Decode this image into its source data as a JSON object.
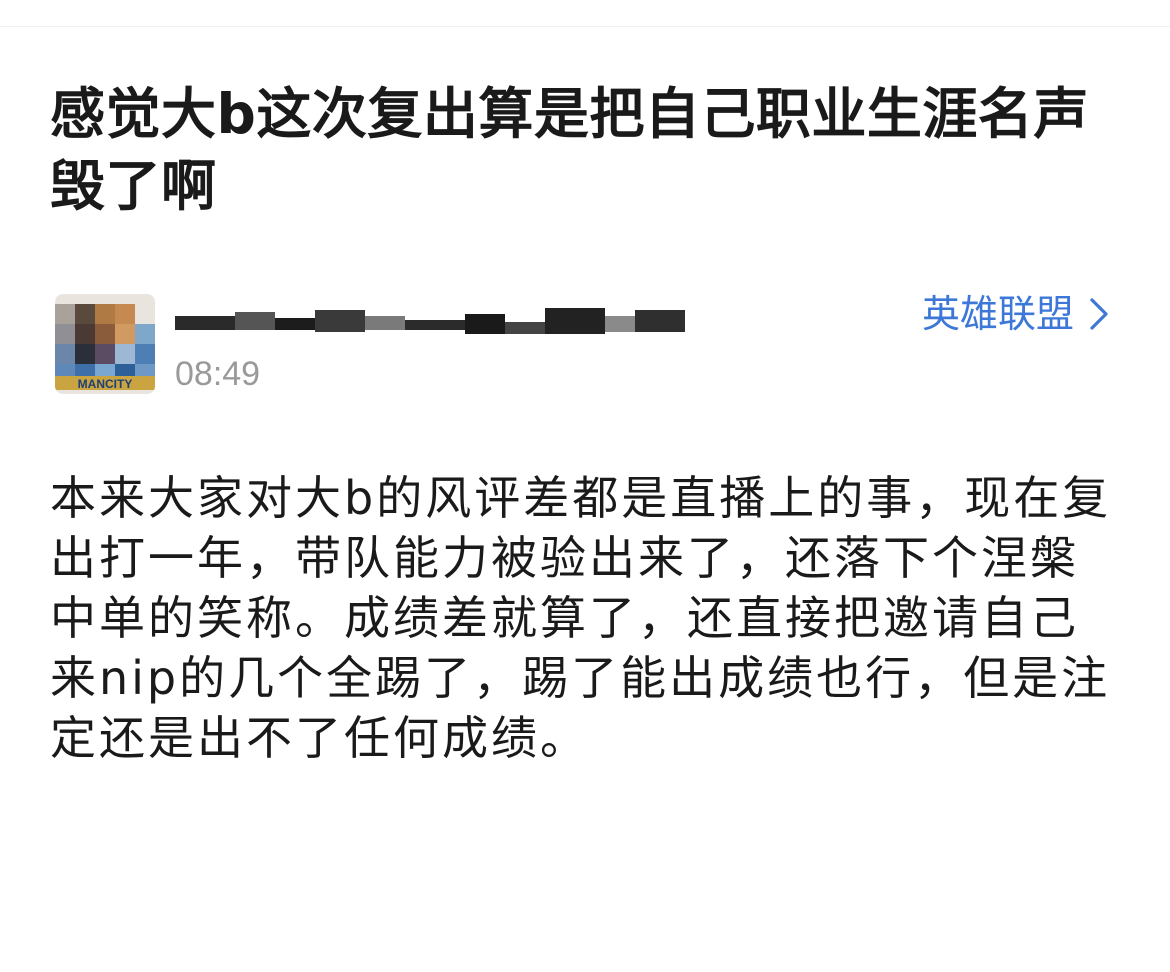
{
  "post": {
    "title": "感觉大b这次复出算是把自己职业生涯名声毁了啊",
    "body": "本来大家对大b的风评差都是直播上的事，现在复出打一年，带队能力被验出来了，还落下个涅槃中单的笑称。成绩差就算了，还直接把邀请自己来nip的几个全踢了，踢了能出成绩也行，但是注定还是出不了任何成绩。"
  },
  "author": {
    "avatar_text": "MANCITY",
    "time": "08:49"
  },
  "forum": {
    "label": "英雄联盟",
    "icon": "chevron-right-icon"
  },
  "colors": {
    "link": "#3d78d8",
    "time": "#9a9a9a",
    "text": "#1a1a1a"
  }
}
